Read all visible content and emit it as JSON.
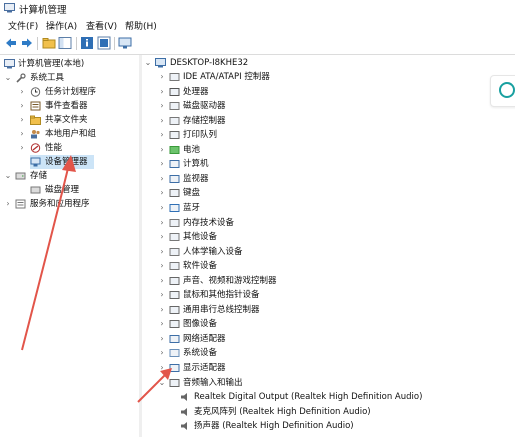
{
  "window": {
    "title": "计算机管理"
  },
  "menu": [
    "文件(F)",
    "操作(A)",
    "查看(V)",
    "帮助(H)"
  ],
  "left_tree": {
    "root": "计算机管理(本地)",
    "system_tools": "系统工具",
    "task_scheduler": "任务计划程序",
    "event_viewer": "事件查看器",
    "shared_folders": "共享文件夹",
    "local_users": "本地用户和组",
    "performance": "性能",
    "device_manager": "设备管理器",
    "storage": "存储",
    "disk_management": "磁盘管理",
    "services": "服务和应用程序"
  },
  "devices": {
    "computer_name": "DESKTOP-I8KHE32",
    "categories": [
      "IDE ATA/ATAPI 控制器",
      "处理器",
      "磁盘驱动器",
      "存储控制器",
      "打印队列",
      "电池",
      "计算机",
      "监视器",
      "键盘",
      "蓝牙",
      "内存技术设备",
      "其他设备",
      "人体学输入设备",
      "软件设备",
      "声音、视频和游戏控制器",
      "鼠标和其他指针设备",
      "通用串行总线控制器",
      "图像设备",
      "网络适配器",
      "系统设备",
      "显示适配器",
      "音频输入和输出"
    ],
    "audio_children": [
      "Realtek Digital Output (Realtek High Definition Audio)",
      "麦克风阵列 (Realtek High Definition Audio)",
      "扬声器 (Realtek High Definition Audio)"
    ]
  },
  "colors": {
    "selection": "#cce4f7",
    "annotation_arrow": "#e2554a"
  }
}
